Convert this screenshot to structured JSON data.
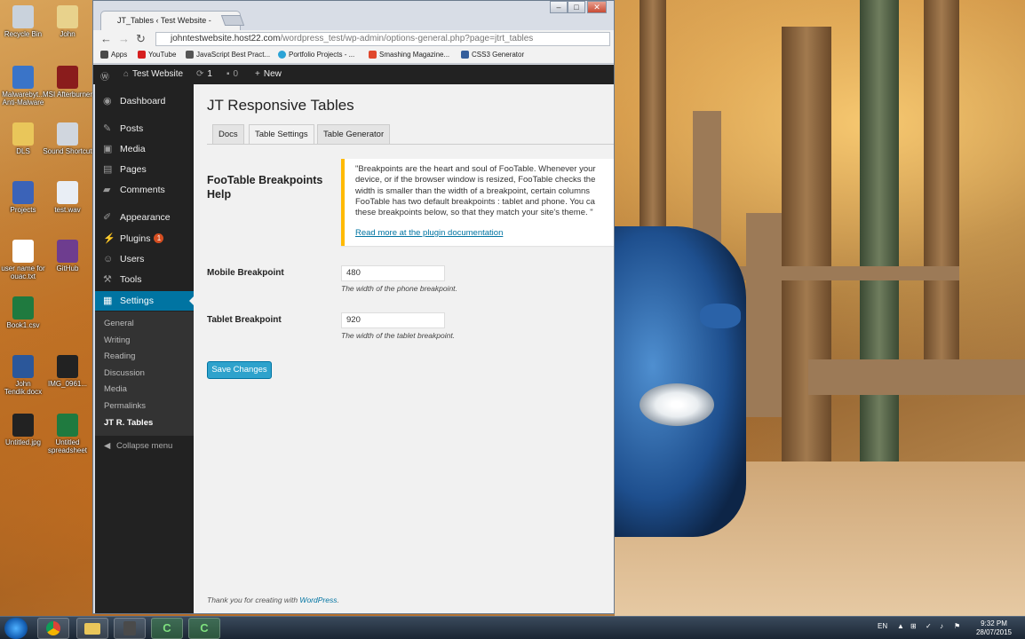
{
  "desktop": {
    "icons": [
      {
        "label": "Recycle Bin",
        "name": "recycle-bin-icon",
        "color": "#c9d2dc"
      },
      {
        "label": "John",
        "name": "user-folder-icon",
        "color": "#e8d28c"
      },
      {
        "label": "Malwarebyt... Anti-Malware",
        "name": "malwarebytes-icon",
        "color": "#3a74c8"
      },
      {
        "label": "MSI Afterburner",
        "name": "msi-afterburner-icon",
        "color": "#8a1c1c"
      },
      {
        "label": "DLS",
        "name": "folder-icon",
        "color": "#e9c65a"
      },
      {
        "label": "Sound Shortcut",
        "name": "sound-shortcut-icon",
        "color": "#d0d6de"
      },
      {
        "label": "Projects",
        "name": "projects-icon",
        "color": "#3b63b8"
      },
      {
        "label": "test.wav",
        "name": "wav-file-icon",
        "color": "#e9eef5"
      },
      {
        "label": "user name for ouac.txt",
        "name": "text-file-icon",
        "color": "#ffffff"
      },
      {
        "label": "GitHub",
        "name": "github-icon",
        "color": "#6e3d8f"
      },
      {
        "label": "Book1.csv",
        "name": "csv-file-icon",
        "color": "#1f7a3f"
      },
      {
        "label": "John Tendik.docx",
        "name": "word-doc-icon",
        "color": "#2b579a"
      },
      {
        "label": "IMG_0961...",
        "name": "image-file-icon",
        "color": "#222222"
      },
      {
        "label": "Untitled.jpg",
        "name": "jpg-file-icon",
        "color": "#222222"
      },
      {
        "label": "Untitled spreadsheet",
        "name": "spreadsheet-icon",
        "color": "#1f7a3f"
      }
    ]
  },
  "browser": {
    "tab_title": "JT_Tables ‹ Test Website -",
    "url_host": "johntestwebsite.host22.com",
    "url_path": "/wordpress_test/wp-admin/options-general.php?page=jtrt_tables",
    "bookmarks": [
      "Apps",
      "YouTube",
      "JavaScript Best Pract...",
      "Portfolio Projects - ...",
      "Smashing Magazine...",
      "CSS3 Generator"
    ]
  },
  "adminbar": {
    "site_name": "Test Website",
    "updates_count": "1",
    "comments_count": "0",
    "new_label": "New"
  },
  "sidebar": {
    "items": [
      {
        "label": "Dashboard",
        "icon": "dashboard-icon",
        "glyph": "◉"
      },
      {
        "label": "Posts",
        "icon": "pin-icon",
        "glyph": "✎"
      },
      {
        "label": "Media",
        "icon": "media-icon",
        "glyph": "▣"
      },
      {
        "label": "Pages",
        "icon": "pages-icon",
        "glyph": "▤"
      },
      {
        "label": "Comments",
        "icon": "comments-icon",
        "glyph": "▰"
      },
      {
        "label": "Appearance",
        "icon": "brush-icon",
        "glyph": "✐"
      },
      {
        "label": "Plugins",
        "icon": "plug-icon",
        "glyph": "⚡"
      },
      {
        "label": "Users",
        "icon": "users-icon",
        "glyph": "☺"
      },
      {
        "label": "Tools",
        "icon": "wrench-icon",
        "glyph": "⚒"
      },
      {
        "label": "Settings",
        "icon": "settings-icon",
        "glyph": "▦"
      }
    ],
    "plugins_badge": "1",
    "submenu": [
      "General",
      "Writing",
      "Reading",
      "Discussion",
      "Media",
      "Permalinks",
      "JT R. Tables"
    ],
    "collapse_label": "Collapse menu"
  },
  "page": {
    "title": "JT Responsive Tables",
    "tabs": [
      "Docs",
      "Table Settings",
      "Table Generator"
    ],
    "active_tab": "Table Settings",
    "help_label": "FooTable Breakpoints Help",
    "notice_lines": [
      "\"Breakpoints are the heart and soul of FooTable. Whenever your",
      "device, or if the browser window is resized, FooTable checks the",
      "width is smaller than the width of a breakpoint, certain columns",
      "FooTable has two default breakpoints : tablet and phone. You ca",
      "these breakpoints below, so that they match your site's theme. \""
    ],
    "notice_link": "Read more at the plugin documentation",
    "fields": [
      {
        "label": "Mobile Breakpoint",
        "value": "480",
        "description": "The width of the phone breakpoint."
      },
      {
        "label": "Tablet Breakpoint",
        "value": "920",
        "description": "The width of the tablet breakpoint."
      }
    ],
    "save_label": "Save Changes",
    "footer_text": "Thank you for creating with ",
    "footer_link": "WordPress",
    "footer_end": "."
  },
  "taskbar": {
    "language": "EN",
    "time": "9:32 PM",
    "date": "28/07/2015"
  },
  "colors": {
    "wp_blue": "#0074a2",
    "wp_button": "#2ea2cc",
    "notice_border": "#ffba00",
    "adminbar_bg": "#222222"
  }
}
